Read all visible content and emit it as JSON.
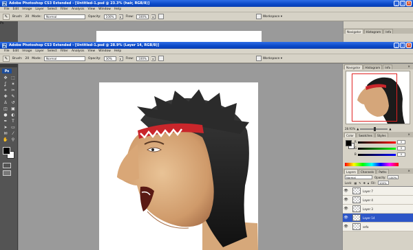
{
  "back_window": {
    "title": "Adobe Photoshop CS3 Extended - [Untitled-1.psd @ 23.3% (hair, RGB/8)]",
    "menu": [
      "File",
      "Edit",
      "Image",
      "Layer",
      "Select",
      "Filter",
      "Analysis",
      "View",
      "Window",
      "Help"
    ],
    "options": {
      "brush_label": "Brush:",
      "brush_size": "20",
      "mode_label": "Mode:",
      "mode_value": "Normal",
      "opacity_label": "Opacity:",
      "opacity_value": "100%",
      "flow_label": "Flow:",
      "flow_value": "100%",
      "workspace_label": "Workspace ▾"
    },
    "panel_tabs": [
      "Navigator",
      "Histogram",
      "Info"
    ]
  },
  "front_window": {
    "title": "Adobe Photoshop CS3 Extended - [Untitled-1.psd @ 28.9% (Layer 14, RGB/8)]",
    "menu": [
      "File",
      "Edit",
      "Image",
      "Layer",
      "Select",
      "Filter",
      "Analysis",
      "View",
      "Window",
      "Help"
    ],
    "options": {
      "brush_label": "Brush:",
      "brush_size": "20",
      "mode_label": "Mode:",
      "mode_value": "Normal",
      "opacity_label": "Opacity:",
      "opacity_value": "30%",
      "flow_label": "Flow:",
      "flow_value": "100%",
      "workspace_label": "Workspace ▾"
    }
  },
  "toolbox": {
    "logo": "Ps",
    "tools": [
      "move-icon",
      "marquee-icon",
      "lasso-icon",
      "magic-wand-icon",
      "crop-icon",
      "slice-icon",
      "healing-icon",
      "brush-icon",
      "stamp-icon",
      "history-brush-icon",
      "eraser-icon",
      "gradient-icon",
      "blur-icon",
      "dodge-icon",
      "pen-icon",
      "type-icon",
      "path-select-icon",
      "shape-icon",
      "notes-icon",
      "eyedropper-icon",
      "hand-icon",
      "zoom-icon"
    ],
    "tool_glyphs": [
      "✥",
      "⬚",
      "ʆ",
      "✶",
      "⌗",
      "✂",
      "✚",
      "✎",
      "♙",
      "↺",
      "◫",
      "▣",
      "●",
      "◐",
      "✒",
      "T",
      "➤",
      "▭",
      "✉",
      "⁄",
      "✋",
      "⚲"
    ]
  },
  "navigator": {
    "tabs": [
      "Navigator",
      "Histogram",
      "Info"
    ],
    "zoom": "28.91%"
  },
  "color_panel": {
    "tabs": [
      "Color",
      "Swatches",
      "Styles"
    ],
    "r_label": "R",
    "g_label": "G",
    "b_label": "B",
    "r": "0",
    "g": "0",
    "b": "0",
    "foreground": "#000000",
    "background": "#ffffff"
  },
  "layers_panel": {
    "tabs": [
      "Layers",
      "Channels",
      "Paths"
    ],
    "blend_mode": "Normal",
    "opacity_label": "Opacity:",
    "opacity": "100%",
    "lock_label": "Lock:",
    "fill_label": "Fill:",
    "fill": "100%",
    "layers": [
      {
        "name": "Layer 7",
        "selected": false,
        "fx": ""
      },
      {
        "name": "Layer 4",
        "selected": false,
        "fx": ""
      },
      {
        "name": "Layer 3",
        "selected": false,
        "fx": ""
      },
      {
        "name": "Layer 14",
        "selected": true,
        "fx": ""
      },
      {
        "name": "sefa",
        "selected": false,
        "fx": ""
      }
    ]
  },
  "colors": {
    "title_blue": "#0a48c8",
    "selection_blue": "#2d56c7",
    "ps_blue": "#1d4d9a",
    "headband_red": "#c9262b"
  }
}
